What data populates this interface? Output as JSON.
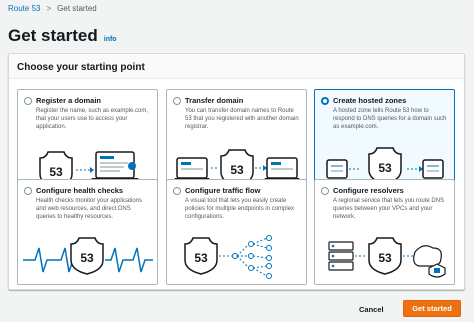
{
  "breadcrumb": {
    "root": "Route 53",
    "separator": ">",
    "current": "Get started"
  },
  "header": {
    "title": "Get started",
    "info": "info"
  },
  "panel": {
    "title": "Choose your starting point"
  },
  "options": [
    {
      "title": "Register a domain",
      "desc": "Register the name, such as example.com, that your users use to access your application.",
      "selected": false,
      "icon": "register-domain-illustration"
    },
    {
      "title": "Transfer domain",
      "desc": "You can transfer domain names to Route 53 that you registered with another domain registrar.",
      "selected": false,
      "icon": "transfer-domain-illustration"
    },
    {
      "title": "Create hosted zones",
      "desc": "A hosted zone tells Route 53 how to respond to DNS queries for a domain such as example.com.",
      "selected": true,
      "icon": "hosted-zones-illustration"
    },
    {
      "title": "Configure health checks",
      "desc": "Health checks monitor your applications and web resources, and direct DNS queries to healthy resources.",
      "selected": false,
      "icon": "health-checks-illustration"
    },
    {
      "title": "Configure traffic flow",
      "desc": "A visual tool that lets you easily create policies for multiple endpoints in complex configurations.",
      "selected": false,
      "icon": "traffic-flow-illustration"
    },
    {
      "title": "Configure resolvers",
      "desc": "A regional service that lets you route DNS queries between your VPCs and your network.",
      "selected": false,
      "icon": "resolvers-illustration"
    }
  ],
  "shield_label": "53",
  "footer": {
    "cancel": "Cancel",
    "primary": "Get started"
  },
  "colors": {
    "accent": "#0073bb",
    "primary_button": "#ec7211",
    "selected_bg": "#f1faff"
  }
}
